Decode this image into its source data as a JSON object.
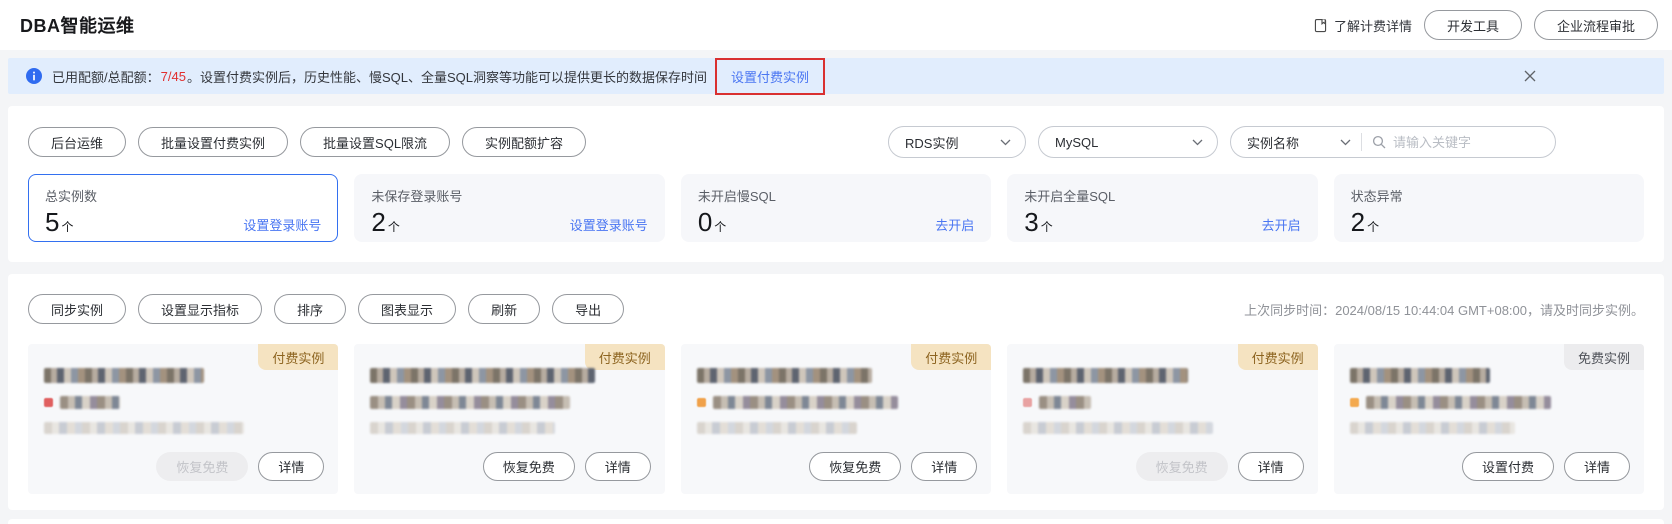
{
  "page": {
    "title": "DBA智能运维"
  },
  "header": {
    "learn_billing_label": "了解计费详情",
    "dev_tools_label": "开发工具",
    "enterprise_approval_label": "企业流程审批"
  },
  "banner": {
    "quota_label": "已用配额/总配额：",
    "quota_value": "7/45",
    "message": "。设置付费实例后，历史性能、慢SQL、全量SQL洞察等功能可以提供更长的数据保存时间",
    "action_link": "设置付费实例"
  },
  "toolbar1": {
    "buttons": [
      "后台运维",
      "批量设置付费实例",
      "批量设置SQL限流",
      "实例配额扩容"
    ],
    "filters": {
      "instance_type_value": "RDS实例",
      "engine_value": "MySQL",
      "search_field_value": "实例名称",
      "search_placeholder": "请输入关键字"
    }
  },
  "stats": {
    "cards": [
      {
        "label": "总实例数",
        "value": "5",
        "unit": "个",
        "link": "设置登录账号"
      },
      {
        "label": "未保存登录账号",
        "value": "2",
        "unit": "个",
        "link": "设置登录账号"
      },
      {
        "label": "未开启慢SQL",
        "value": "0",
        "unit": "个",
        "link": "去开启"
      },
      {
        "label": "未开启全量SQL",
        "value": "3",
        "unit": "个",
        "link": "去开启"
      },
      {
        "label": "状态异常",
        "value": "2",
        "unit": "个"
      }
    ]
  },
  "toolbar2": {
    "buttons": [
      "同步实例",
      "设置显示指标",
      "排序",
      "图表显示",
      "刷新",
      "导出"
    ],
    "sync_label": "上次同步时间：",
    "sync_value": "2024/08/15 10:44:04 GMT+08:00，请及时同步实例。"
  },
  "instances": {
    "cards": [
      {
        "badge": "付费实例",
        "type": "paid",
        "status_color": "#e06060",
        "actions": [
          {
            "label": "恢复免费"
          },
          {
            "label": "详情"
          }
        ]
      },
      {
        "badge": "付费实例",
        "type": "paid",
        "status_color": null,
        "actions": [
          {
            "label": "恢复免费"
          },
          {
            "label": "详情"
          }
        ]
      },
      {
        "badge": "付费实例",
        "type": "paid",
        "status_color": "#f0a14a",
        "actions": [
          {
            "label": "恢复免费"
          },
          {
            "label": "详情"
          }
        ]
      },
      {
        "badge": "付费实例",
        "type": "paid",
        "status_color": "#e8a2a2",
        "actions": [
          {
            "label": "恢复免费"
          },
          {
            "label": "详情"
          }
        ]
      },
      {
        "badge": "免费实例",
        "type": "free",
        "status_color": "#f3a94f",
        "actions": [
          {
            "label": "设置付费"
          },
          {
            "label": "详情"
          }
        ]
      }
    ]
  },
  "colors": {
    "accent_blue": "#4a76f2",
    "quota_red": "#e12f2f",
    "annotation_red": "#d93030",
    "banner_bg": "#e1edfd",
    "paid_badge_bg": "#f5e3c1",
    "paid_badge_text": "#8d6420",
    "free_badge_bg": "#ececee",
    "free_badge_text": "#4e5158",
    "selected_card_border": "#3370f0"
  }
}
